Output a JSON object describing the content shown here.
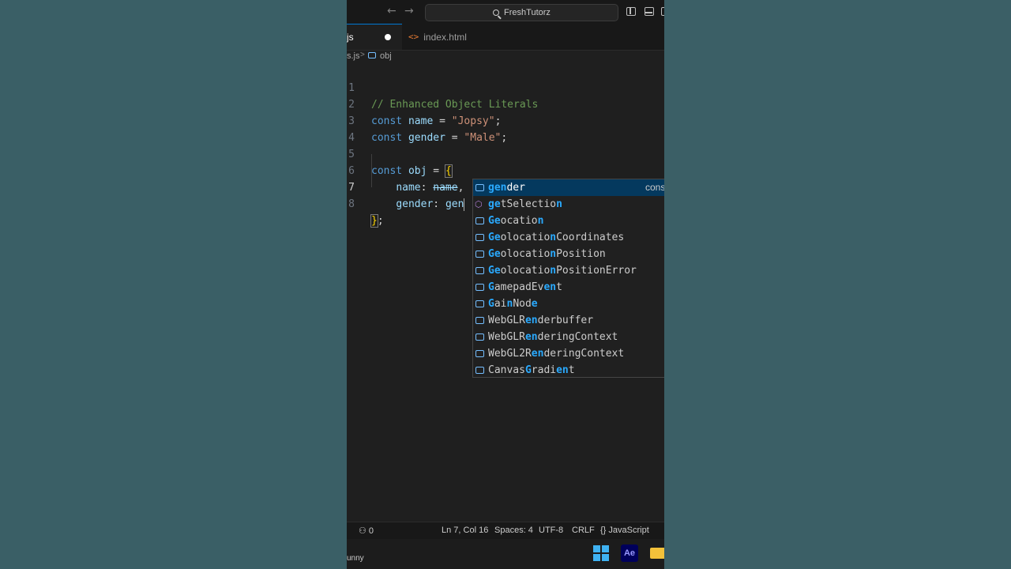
{
  "titlebar": {
    "search_text": "FreshTutorz"
  },
  "tabs": [
    {
      "label": "js",
      "active": true,
      "modified": true
    },
    {
      "label": "index.html",
      "active": false
    }
  ],
  "breadcrumb": {
    "file": "s.js",
    "separator": ">",
    "symbol": "obj"
  },
  "editor": {
    "line_numbers": [
      "1",
      "2",
      "3",
      "4",
      "5",
      "6",
      "7",
      "8"
    ],
    "lines": {
      "l1": {
        "comment": "// Enhanced Object Literals"
      },
      "l2": {
        "kw": "const",
        "var": "name",
        "op": " = ",
        "str": "\"Jopsy\"",
        "end": ";"
      },
      "l3": {
        "kw": "const",
        "var": "gender",
        "op": " = ",
        "str": "\"Male\"",
        "end": ";"
      },
      "l5": {
        "kw": "const",
        "var": "obj",
        "op": " = ",
        "brace": "{"
      },
      "l6": {
        "key": "name",
        "colon": ": ",
        "val": "name",
        "end": ","
      },
      "l7": {
        "key": "gender",
        "colon": ": ",
        "val": "gen"
      },
      "l8": {
        "brace": "}",
        "end": ";"
      }
    }
  },
  "suggestions": [
    {
      "match": "gen",
      "rest": "der",
      "kind": "variable",
      "detail": "cons"
    },
    {
      "pre": "",
      "label_parts": [
        "g",
        "et",
        "S",
        "el",
        "ection"
      ],
      "kind": "method"
    },
    {
      "kind": "variable"
    },
    {
      "kind": "variable"
    },
    {
      "kind": "variable"
    },
    {
      "kind": "variable"
    },
    {
      "kind": "variable"
    },
    {
      "kind": "variable"
    },
    {
      "kind": "variable"
    },
    {
      "kind": "variable"
    },
    {
      "kind": "variable"
    },
    {
      "kind": "variable"
    }
  ],
  "suggestion_labels": [
    "gender",
    "getSelection",
    "Geolocation",
    "GeolocationCoordinates",
    "GeolocationPosition",
    "GeolocationPositionError",
    "GamepadEvent",
    "GainNode",
    "WebGLRenderbuffer",
    "WebGLRenderingContext",
    "WebGL2RenderingContext",
    "CanvasGradient"
  ],
  "statusbar": {
    "ports": "0",
    "position": "Ln 7, Col 16",
    "spaces": "Spaces: 4",
    "encoding": "UTF-8",
    "eol": "CRLF",
    "language_bracket": "{}",
    "language": "JavaScript"
  },
  "taskbar": {
    "weather_text": "unny",
    "ae_label": "Ae"
  },
  "colors": {
    "accent": "#0078d4",
    "keyword": "#569cd6",
    "variable": "#9cdcfe",
    "string": "#ce9178",
    "comment": "#6a9955",
    "match_highlight": "#2aaaff",
    "selected_row": "#04395e"
  }
}
